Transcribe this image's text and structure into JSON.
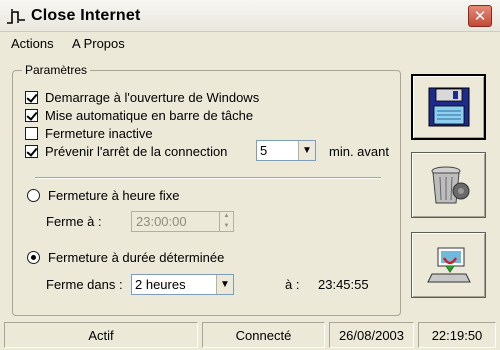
{
  "window": {
    "title": "Close Internet"
  },
  "menu": {
    "items": [
      "Actions",
      "A Propos"
    ]
  },
  "group": {
    "title": "Paramètres"
  },
  "options": [
    {
      "label": "Demarrage à l'ouverture de Windows",
      "checked": true
    },
    {
      "label": "Mise automatique en barre de tâche",
      "checked": true
    },
    {
      "label": "Fermeture inactive",
      "checked": false
    },
    {
      "label": "Prévenir l'arrêt de la connection",
      "checked": true
    }
  ],
  "warning": {
    "minutes_value": "5",
    "suffix": "min. avant"
  },
  "fixed_time": {
    "label": "Fermeture à heure fixe",
    "selected": false,
    "field_label": "Ferme à :",
    "value": "23:00:00"
  },
  "duration": {
    "label": "Fermeture à durée déterminée",
    "selected": true,
    "field_label": "Ferme dans :",
    "value": "2 heures",
    "at_label": "à :",
    "at_time": "23:45:55"
  },
  "status": {
    "state": "Actif",
    "connection": "Connecté",
    "date": "26/08/2003",
    "time": "22:19:50"
  },
  "icons": {
    "app": "close-internet-app-icon",
    "save": "floppy-disk-icon",
    "trash": "trash-can-icon",
    "connect": "network-computer-icon"
  }
}
